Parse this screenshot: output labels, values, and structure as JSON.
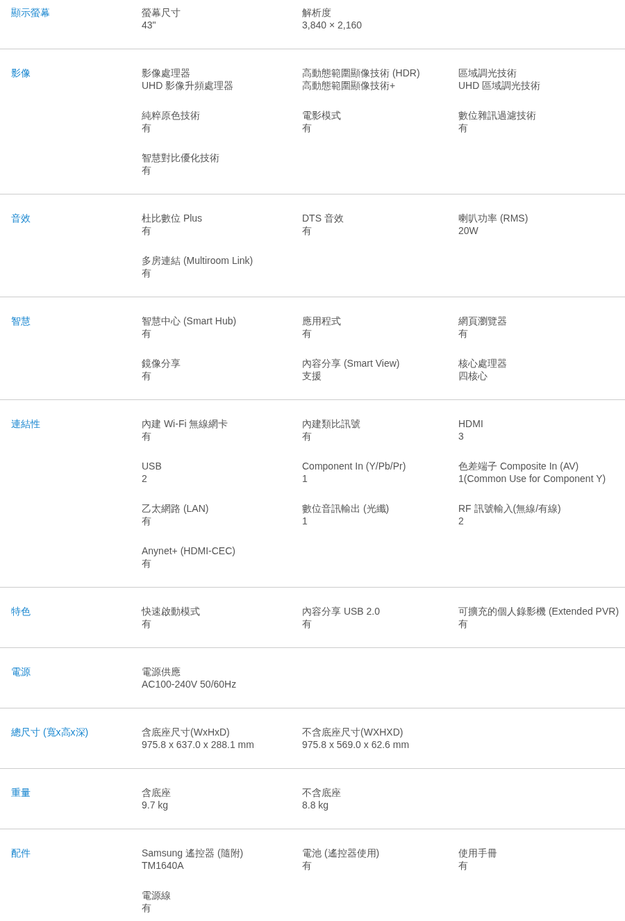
{
  "sections": [
    {
      "title": "顯示螢幕",
      "items": [
        {
          "label": "螢幕尺寸",
          "value": "43\""
        },
        {
          "label": "解析度",
          "value": "3,840 × 2,160"
        }
      ]
    },
    {
      "title": "影像",
      "items": [
        {
          "label": "影像處理器",
          "value": "UHD 影像升頻處理器"
        },
        {
          "label": "高動態範圍顯像技術 (HDR)",
          "value": "高動態範圍顯像技術+"
        },
        {
          "label": "區域調光技術",
          "value": "UHD 區域調光技術"
        },
        {
          "label": "純粹原色技術",
          "value": "有"
        },
        {
          "label": "電影模式",
          "value": "有"
        },
        {
          "label": "數位雜訊過濾技術",
          "value": "有"
        },
        {
          "label": "智慧對比優化技術",
          "value": "有"
        }
      ]
    },
    {
      "title": "音效",
      "items": [
        {
          "label": "杜比數位 Plus",
          "value": "有"
        },
        {
          "label": "DTS 音效",
          "value": "有"
        },
        {
          "label": "喇叭功率 (RMS)",
          "value": "20W"
        },
        {
          "label": "多房連結 (Multiroom Link)",
          "value": "有"
        }
      ]
    },
    {
      "title": "智慧",
      "items": [
        {
          "label": "智慧中心 (Smart Hub)",
          "value": "有"
        },
        {
          "label": "應用程式",
          "value": "有"
        },
        {
          "label": "網頁瀏覽器",
          "value": "有"
        },
        {
          "label": "鏡像分享",
          "value": "有"
        },
        {
          "label": "內容分享 (Smart View)",
          "value": "支援"
        },
        {
          "label": "核心處理器",
          "value": "四核心"
        }
      ]
    },
    {
      "title": "連結性",
      "items": [
        {
          "label": "內建 Wi-Fi 無線網卡",
          "value": "有"
        },
        {
          "label": "內建類比訊號",
          "value": "有"
        },
        {
          "label": "HDMI",
          "value": "3"
        },
        {
          "label": "USB",
          "value": "2"
        },
        {
          "label": "Component In (Y/Pb/Pr)",
          "value": "1"
        },
        {
          "label": "色差端子 Composite In (AV)",
          "value": "1(Common Use for Component Y)"
        },
        {
          "label": "乙太網路 (LAN)",
          "value": "有"
        },
        {
          "label": "數位音訊輸出 (光纖)",
          "value": "1"
        },
        {
          "label": "RF 訊號輸入(無線/有線)",
          "value": "2"
        },
        {
          "label": "Anynet+ (HDMI-CEC)",
          "value": "有"
        }
      ]
    },
    {
      "title": "特色",
      "items": [
        {
          "label": "快速啟動模式",
          "value": "有"
        },
        {
          "label": "內容分享 USB 2.0",
          "value": "有"
        },
        {
          "label": "可擴充的個人錄影機 (Extended PVR)",
          "value": "有"
        }
      ]
    },
    {
      "title": "電源",
      "items": [
        {
          "label": "電源供應",
          "value": "AC100-240V 50/60Hz"
        }
      ]
    },
    {
      "title": "總尺寸 (寬x高x深)",
      "items": [
        {
          "label": "含底座尺寸(WxHxD)",
          "value": "975.8 x 637.0 x 288.1 mm"
        },
        {
          "label": "不含底座尺寸(WXHXD)",
          "value": "975.8 x 569.0 x 62.6 mm"
        }
      ]
    },
    {
      "title": "重量",
      "items": [
        {
          "label": "含底座",
          "value": "9.7 kg"
        },
        {
          "label": "不含底座",
          "value": "8.8 kg"
        }
      ]
    },
    {
      "title": "配件",
      "items": [
        {
          "label": "Samsung 遙控器 (隨附)",
          "value": "TM1640A"
        },
        {
          "label": "電池 (遙控器使用)",
          "value": "有"
        },
        {
          "label": "使用手冊",
          "value": "有"
        },
        {
          "label": "電源線",
          "value": "有"
        }
      ]
    }
  ]
}
